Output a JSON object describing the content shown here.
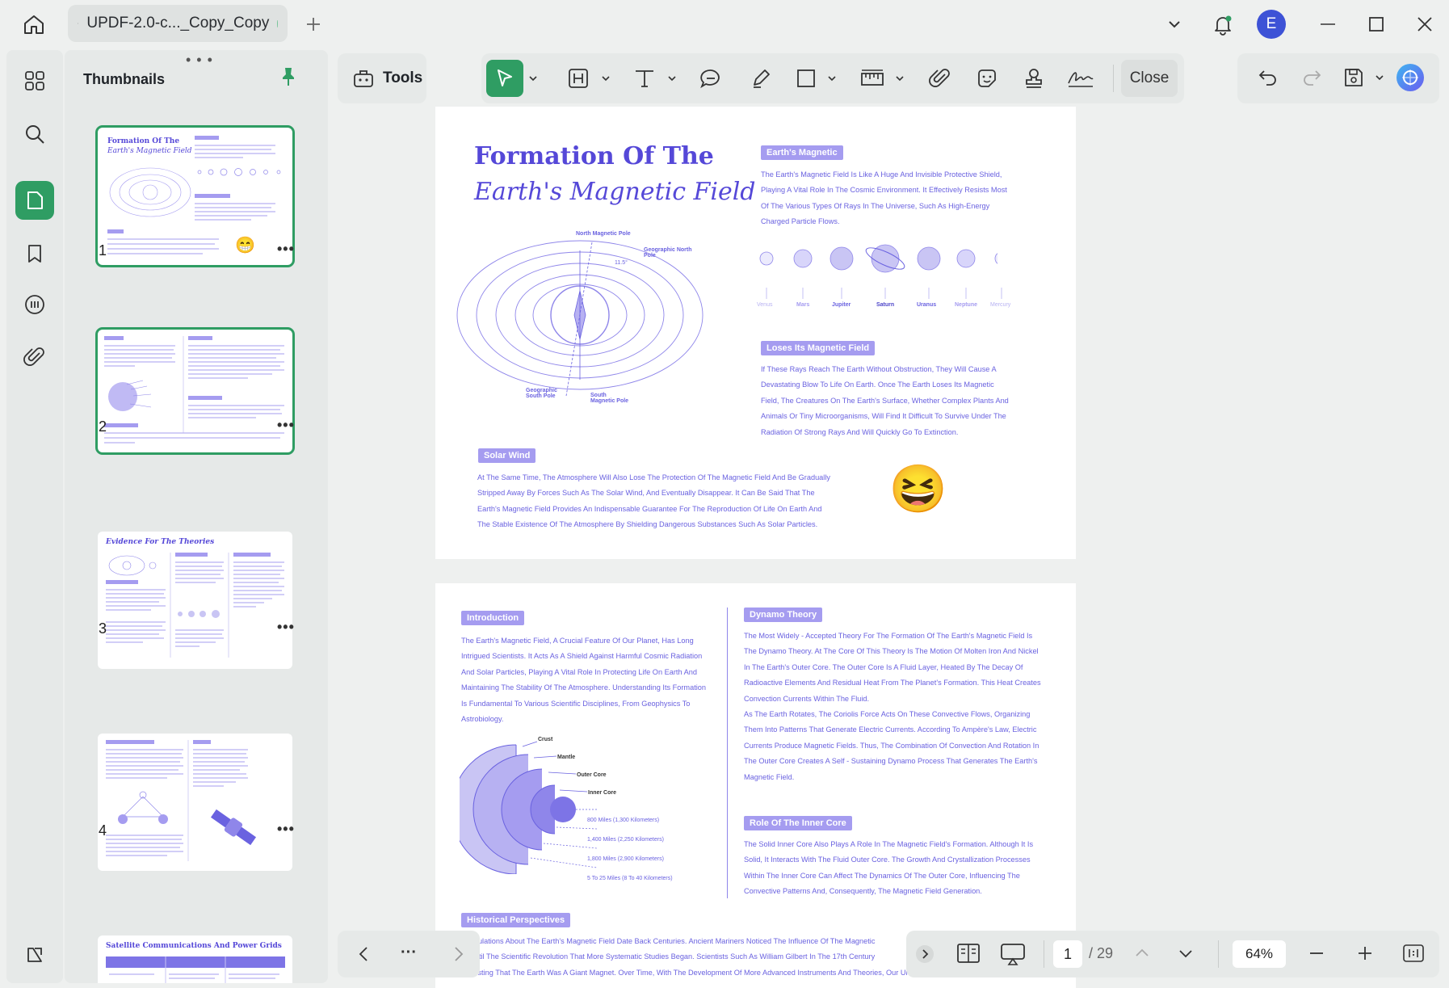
{
  "tab": {
    "title": "UPDF-2.0-c..._Copy_Copy"
  },
  "avatar": {
    "letter": "E"
  },
  "sidebar": {
    "title": "Thumbnails",
    "grip": "• • •",
    "more": "•••",
    "pages": [
      {
        "num": "1",
        "mini_title": "Formation Of The",
        "mini_sub": "Earth's Magnetic Field"
      },
      {
        "num": "2"
      },
      {
        "num": "3",
        "mini_title": "Evidence For The Theories"
      },
      {
        "num": "4"
      },
      {
        "mini_title": "Satellite Communications And Power Grids"
      }
    ]
  },
  "toolbar": {
    "tools_label": "Tools",
    "close_label": "Close"
  },
  "page1": {
    "title_line1": "Formation Of The",
    "title_line2": "Earth's Magnetic Field",
    "magnetic_tag": "Earth's Magnetic",
    "magnetic_text": [
      "The Earth's Magnetic Field Is Like A Huge And Invisible Protective Shield,",
      "Playing A Vital Role In The Cosmic Environment. It Effectively Resists Most",
      "Of The Various Types Of Rays In The Universe, Such As High-Energy",
      "Charged Particle Flows."
    ],
    "planets": [
      "Venus",
      "Mars",
      "Jupiter",
      "Saturn",
      "Uranus",
      "Neptune",
      "Mercury"
    ],
    "loses_tag": "Loses Its Magnetic Field",
    "loses_text": [
      "If These Rays Reach The Earth Without Obstruction, They Will Cause A",
      "Devastating Blow To Life On Earth. Once The Earth Loses Its Magnetic",
      "Field, The Creatures On The Earth's Surface, Whether Complex Plants And",
      "Animals Or Tiny Microorganisms, Will Find It Difficult To Survive Under The",
      "Radiation Of Strong Rays And Will Quickly Go To Extinction."
    ],
    "diagram": {
      "north_pole": "North Magnetic Pole",
      "geo_north": "Geographic North Pole",
      "geo_south": "Geographic South Pole",
      "south_pole": "South Magnetic Pole",
      "angle": "11.5°"
    },
    "solar_tag": "Solar Wind",
    "solar_text": [
      "At The Same Time, The Atmosphere Will Also Lose The Protection Of The Magnetic Field And Be Gradually",
      "Stripped Away By Forces Such As The Solar Wind, And Eventually Disappear. It Can Be Said That The",
      "Earth's Magnetic Field Provides An Indispensable Guarantee For The Reproduction Of Life On Earth And",
      "The Stable Existence Of The Atmosphere By Shielding Dangerous Substances Such As Solar Particles."
    ]
  },
  "page2": {
    "intro_tag": "Introduction",
    "intro_text": [
      "The Earth's Magnetic Field, A Crucial Feature Of Our Planet, Has Long",
      "Intrigued Scientists. It Acts As A Shield Against Harmful Cosmic Radiation",
      "And Solar Particles, Playing A Vital Role In Protecting Life On Earth And",
      "Maintaining The Stability Of The Atmosphere. Understanding Its Formation",
      "Is Fundamental To Various Scientific Disciplines, From Geophysics To",
      "Astrobiology."
    ],
    "layers": [
      "Crust",
      "Mantle",
      "Outer Core",
      "Inner Core"
    ],
    "depths": [
      "800 Miles (1,300 Kilometers)",
      "1,400 Miles (2,250 Kilometers)",
      "1,800 Miles (2,900 Kilometers)",
      "5 To 25 Miles (8 To 40 Kilometers)"
    ],
    "dynamo_tag": "Dynamo Theory",
    "dynamo_text": [
      "The Most Widely - Accepted Theory For The Formation Of The Earth's Magnetic Field Is",
      "The Dynamo Theory. At The Core Of This Theory Is The Motion Of Molten Iron And Nickel",
      "In The Earth's Outer Core. The Outer Core Is A Fluid Layer, Heated By The Decay Of",
      "Radioactive Elements And Residual Heat From The Planet's Formation. This Heat Creates",
      "Convection Currents Within The Fluid.",
      "As The Earth Rotates, The Coriolis Force Acts On These Convective Flows, Organizing",
      "Them Into Patterns That Generate Electric Currents. According To Ampère's Law, Electric",
      "Currents Produce Magnetic Fields. Thus, The Combination Of Convection And Rotation In",
      "The Outer Core Creates A Self - Sustaining Dynamo Process That Generates The Earth's",
      "Magnetic Field."
    ],
    "inner_tag": "Role Of The Inner Core",
    "inner_text": [
      "The Solid Inner Core Also Plays A Role In The Magnetic Field's Formation. Although It Is",
      "Solid, It Interacts With The Fluid Outer Core. The Growth And Crystallization Processes",
      "Within The Inner Core Can Affect The Dynamics Of The Outer Core, Influencing The",
      "Convective Patterns And, Consequently, The Magnetic Field Generation."
    ],
    "hist_tag": "Historical Perspectives",
    "hist_text": [
      "Speculations About The Earth's Magnetic Field Date Back Centuries. Ancient Mariners Noticed The Influence Of The Magnetic",
      "ot Until The Scientific Revolution That More Systematic Studies Began. Scientists Such As William Gilbert In The 17th Century",
      "uggesting That The Earth Was A Giant Magnet. Over Time, With The Development Of More Advanced Instruments And Theories, Our Understanding Of The Magnetic"
    ]
  },
  "nav": {
    "more": "···"
  },
  "status": {
    "page": "1",
    "total": "/ 29",
    "zoom": "64%"
  },
  "colors": {
    "accent": "#2f9d63",
    "doc_purple": "#6a62e0",
    "tag_bg": "#a59cf0"
  }
}
